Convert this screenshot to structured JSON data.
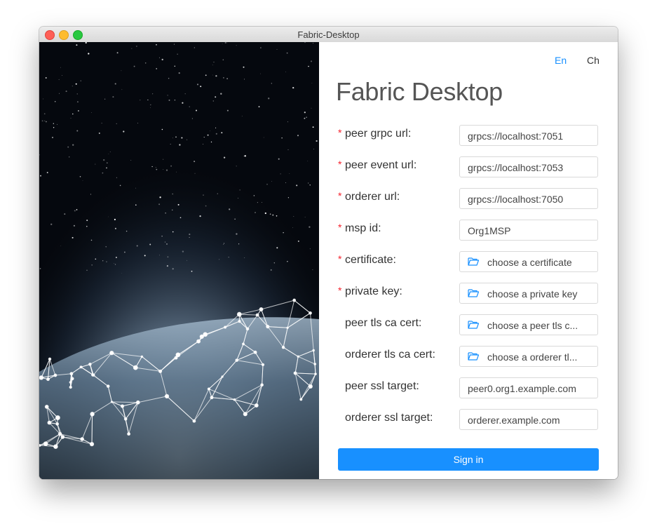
{
  "window": {
    "title": "Fabric-Desktop"
  },
  "language": {
    "en": "En",
    "ch": "Ch",
    "active": "En"
  },
  "colors": {
    "accent": "#1890ff",
    "required": "#f5222d"
  },
  "app_title": "Fabric Desktop",
  "form": {
    "peer_grpc_url": {
      "label": "peer grpc url:",
      "required": true,
      "value": "grpcs://localhost:7051"
    },
    "peer_event_url": {
      "label": "peer event url:",
      "required": true,
      "value": "grpcs://localhost:7053"
    },
    "orderer_url": {
      "label": "orderer url:",
      "required": true,
      "value": "grpcs://localhost:7050"
    },
    "msp_id": {
      "label": "msp id:",
      "required": true,
      "value": "Org1MSP"
    },
    "certificate": {
      "label": "certificate:",
      "required": true,
      "button": "choose a certificate",
      "icon": "folder-open-icon"
    },
    "private_key": {
      "label": "private key:",
      "required": true,
      "button": "choose a private key",
      "icon": "folder-open-icon"
    },
    "peer_tls_ca_cert": {
      "label": "peer tls ca cert:",
      "required": false,
      "button": "choose a peer tls c...",
      "icon": "folder-open-icon"
    },
    "orderer_tls_ca_cert": {
      "label": "orderer tls ca cert:",
      "required": false,
      "button": "choose a orderer tl...",
      "icon": "folder-open-icon"
    },
    "peer_ssl_target": {
      "label": "peer ssl target:",
      "required": false,
      "value": "peer0.org1.example.com"
    },
    "orderer_ssl_target": {
      "label": "orderer ssl target:",
      "required": false,
      "value": "orderer.example.com"
    }
  },
  "signin_label": "Sign in"
}
